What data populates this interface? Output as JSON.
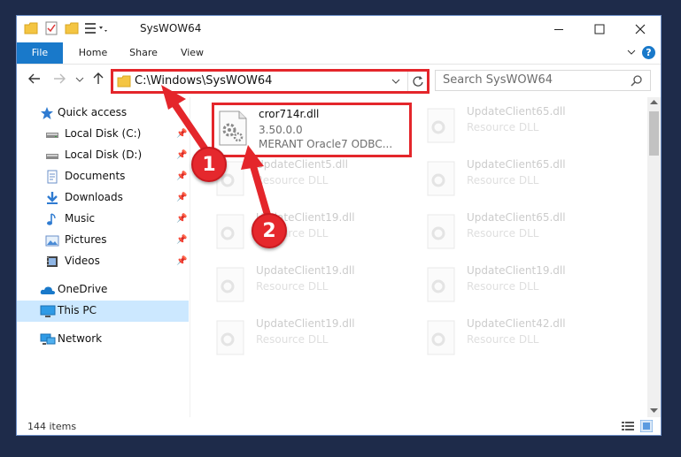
{
  "window": {
    "title": "SysWOW64"
  },
  "ribbon": {
    "tabs": [
      "File",
      "Home",
      "Share",
      "View"
    ],
    "help": "?"
  },
  "address": {
    "path": "C:\\Windows\\SysWOW64"
  },
  "search": {
    "placeholder": "Search SysWOW64"
  },
  "sidebar": {
    "items": [
      {
        "label": "Quick access",
        "icon": "star-icon"
      },
      {
        "label": "Local Disk (C:)",
        "icon": "drive-icon",
        "pinned": true
      },
      {
        "label": "Local Disk (D:)",
        "icon": "drive-icon",
        "pinned": true
      },
      {
        "label": "Documents",
        "icon": "documents-icon",
        "pinned": true
      },
      {
        "label": "Downloads",
        "icon": "download-icon",
        "pinned": true
      },
      {
        "label": "Music",
        "icon": "music-icon",
        "pinned": true
      },
      {
        "label": "Pictures",
        "icon": "pictures-icon",
        "pinned": true
      },
      {
        "label": "Videos",
        "icon": "videos-icon",
        "pinned": true
      },
      {
        "label": "OneDrive",
        "icon": "cloud-icon"
      },
      {
        "label": "This PC",
        "icon": "computer-icon",
        "selected": true
      },
      {
        "label": "Network",
        "icon": "network-icon"
      }
    ]
  },
  "files": {
    "highlighted": {
      "name": "cror714r.dll",
      "version": "3.50.0.0",
      "description": "MERANT Oracle7 ODBC..."
    },
    "faded": [
      {
        "name": "UpdateClient65.dll",
        "type": "Resource DLL"
      },
      {
        "name": "UpdateClient5.dll",
        "type": "Resource DLL"
      },
      {
        "name": "UpdateClient65.dll",
        "type": "Resource DLL"
      },
      {
        "name": "UpdateClient19.dll",
        "type": "Resource DLL"
      },
      {
        "name": "UpdateClient65.dll",
        "type": "Resource DLL"
      },
      {
        "name": "UpdateClient19.dll",
        "type": "Resource DLL"
      },
      {
        "name": "UpdateClient19.dll",
        "type": "Resource DLL"
      },
      {
        "name": "UpdateClient19.dll",
        "type": "Resource DLL"
      },
      {
        "name": "UpdateClient42.dll",
        "type": "Resource DLL"
      }
    ]
  },
  "status": {
    "count": "144 items"
  },
  "annotations": {
    "marker1": "1",
    "marker2": "2",
    "color": "#e4262b"
  }
}
